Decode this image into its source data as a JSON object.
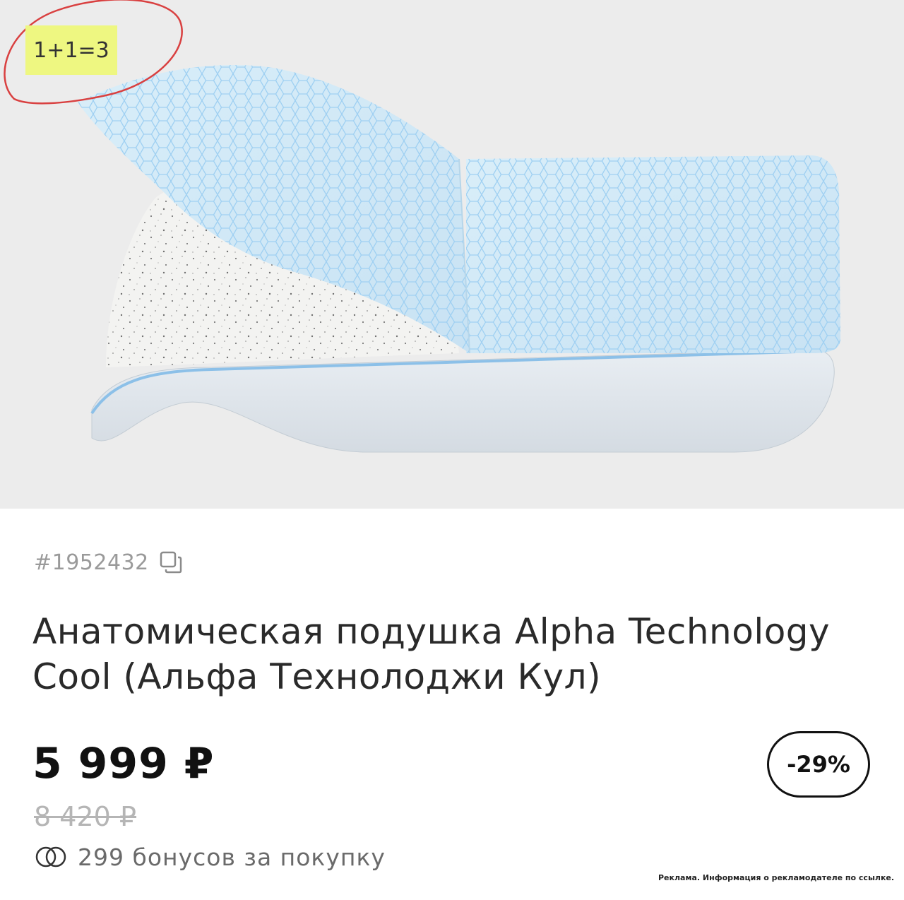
{
  "product": {
    "promo_label": "1+1=3",
    "sku": "#1952432",
    "title_line1": "Анатомическая подушка Alpha Technology",
    "title_line2": "Cool (Альфа Технолоджи Кул)",
    "price_current": "5 999 ₽",
    "price_old": "8 420 ₽",
    "discount": "-29%",
    "bonus_text": "299 бонусов за покупку"
  },
  "footer": {
    "ad_note": "Реклама. Информация о рекламодателе по ссылке."
  },
  "colors": {
    "image_background": "#ececec",
    "promo_badge": "#eef781",
    "annotation_circle": "#d94040",
    "pillow_cover": "#cfe6f4",
    "pillow_piping": "#8cc0e8"
  },
  "icons": {
    "copy": "copy-icon",
    "bonus": "bonus-coins-icon"
  }
}
